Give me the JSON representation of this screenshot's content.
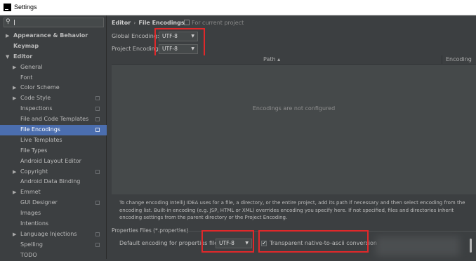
{
  "window": {
    "title": "Settings"
  },
  "sidebar": {
    "search_value": "",
    "items": [
      {
        "label": "Appearance & Behavior",
        "arrow": "▶",
        "bold": true,
        "depth": 0,
        "project_icon": false,
        "selected": false
      },
      {
        "label": "Keymap",
        "arrow": "",
        "bold": true,
        "depth": 0,
        "project_icon": false,
        "selected": false
      },
      {
        "label": "Editor",
        "arrow": "▼",
        "bold": true,
        "depth": 0,
        "project_icon": false,
        "selected": false
      },
      {
        "label": "General",
        "arrow": "▶",
        "bold": false,
        "depth": 1,
        "project_icon": false,
        "selected": false
      },
      {
        "label": "Font",
        "arrow": "",
        "bold": false,
        "depth": 1,
        "project_icon": false,
        "selected": false
      },
      {
        "label": "Color Scheme",
        "arrow": "▶",
        "bold": false,
        "depth": 1,
        "project_icon": false,
        "selected": false
      },
      {
        "label": "Code Style",
        "arrow": "▶",
        "bold": false,
        "depth": 1,
        "project_icon": true,
        "selected": false
      },
      {
        "label": "Inspections",
        "arrow": "",
        "bold": false,
        "depth": 1,
        "project_icon": true,
        "selected": false
      },
      {
        "label": "File and Code Templates",
        "arrow": "",
        "bold": false,
        "depth": 1,
        "project_icon": true,
        "selected": false
      },
      {
        "label": "File Encodings",
        "arrow": "",
        "bold": false,
        "depth": 1,
        "project_icon": true,
        "selected": true
      },
      {
        "label": "Live Templates",
        "arrow": "",
        "bold": false,
        "depth": 1,
        "project_icon": false,
        "selected": false
      },
      {
        "label": "File Types",
        "arrow": "",
        "bold": false,
        "depth": 1,
        "project_icon": false,
        "selected": false
      },
      {
        "label": "Android Layout Editor",
        "arrow": "",
        "bold": false,
        "depth": 1,
        "project_icon": false,
        "selected": false
      },
      {
        "label": "Copyright",
        "arrow": "▶",
        "bold": false,
        "depth": 1,
        "project_icon": true,
        "selected": false
      },
      {
        "label": "Android Data Binding",
        "arrow": "",
        "bold": false,
        "depth": 1,
        "project_icon": false,
        "selected": false
      },
      {
        "label": "Emmet",
        "arrow": "▶",
        "bold": false,
        "depth": 1,
        "project_icon": false,
        "selected": false
      },
      {
        "label": "GUI Designer",
        "arrow": "",
        "bold": false,
        "depth": 1,
        "project_icon": true,
        "selected": false
      },
      {
        "label": "Images",
        "arrow": "",
        "bold": false,
        "depth": 1,
        "project_icon": false,
        "selected": false
      },
      {
        "label": "Intentions",
        "arrow": "",
        "bold": false,
        "depth": 1,
        "project_icon": false,
        "selected": false
      },
      {
        "label": "Language Injections",
        "arrow": "▶",
        "bold": false,
        "depth": 1,
        "project_icon": true,
        "selected": false
      },
      {
        "label": "Spelling",
        "arrow": "",
        "bold": false,
        "depth": 1,
        "project_icon": true,
        "selected": false
      },
      {
        "label": "TODO",
        "arrow": "",
        "bold": false,
        "depth": 1,
        "project_icon": false,
        "selected": false
      }
    ]
  },
  "main": {
    "breadcrumb": {
      "parent": "Editor",
      "separator": "›",
      "current": "File Encodings"
    },
    "scope_note": "For current project",
    "global_encoding": {
      "label": "Global Encoding:",
      "value": "UTF-8"
    },
    "project_encoding": {
      "label": "Project Encoding:",
      "value": "UTF-8"
    },
    "table": {
      "col_path": "Path ▴",
      "col_encoding": "Encoding",
      "empty_text": "Encodings are not configured"
    },
    "description": "To change encoding IntelliJ IDEA uses for a file, a directory, or the entire project, add its path if necessary and then select encoding from the encoding list. Built-in encoding (e.g. JSP, HTML or XML) overrides encoding you specify here. If not specified, files and directories inherit encoding settings from the parent directory or the Project Encoding.",
    "properties": {
      "section_title": "Properties Files (*.properties)",
      "default_label": "Default encoding for properties files:",
      "default_value": "UTF-8",
      "transparent_label": "Transparent native-to-ascii conversion",
      "transparent_checked": true
    }
  },
  "colors": {
    "highlight": "#e0282a",
    "selection": "#4b6eaf",
    "background": "#3c3f41"
  }
}
